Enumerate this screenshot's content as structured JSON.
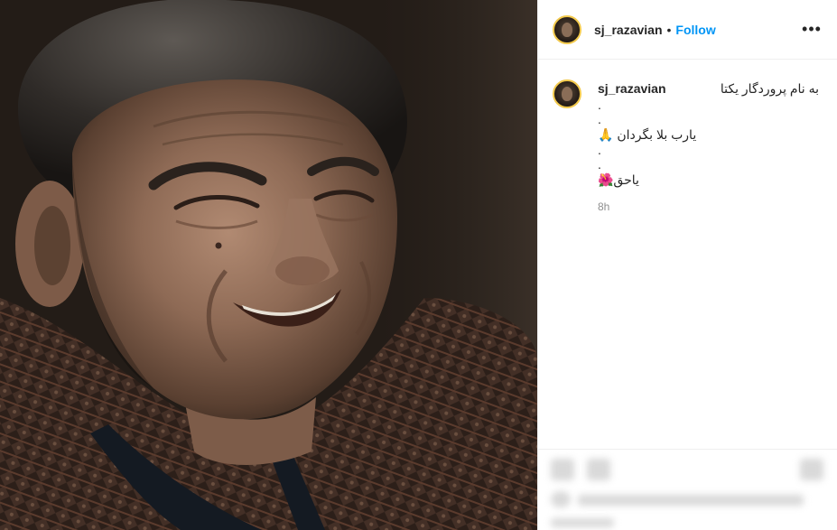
{
  "header": {
    "username": "sj_razavian",
    "separator": "•",
    "follow_label": "Follow",
    "more_label": "•••"
  },
  "caption": {
    "username": "sj_razavian",
    "lines": [
      "به نام پروردگار یکتا",
      ".",
      ".",
      "یارب بلا بگردان 🙏",
      ".",
      ".",
      "یاحق🌺"
    ]
  },
  "time": "8h",
  "colors": {
    "follow": "#0095f6",
    "avatar_ring": "#f2c94c",
    "time": "#8e8e8e"
  },
  "icons": [
    "more-options-icon",
    "avatar"
  ]
}
